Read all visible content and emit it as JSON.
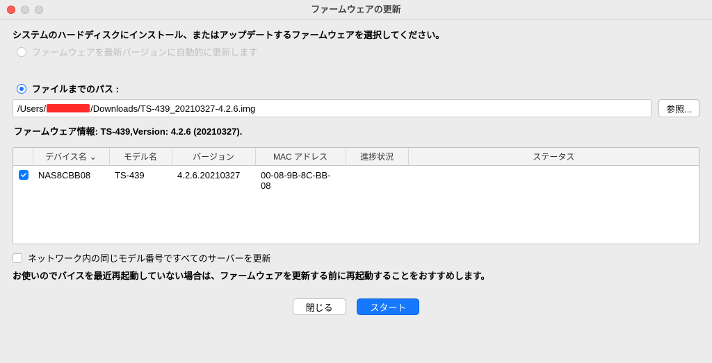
{
  "window": {
    "title": "ファームウェアの更新"
  },
  "instruction": "システムのハードディスクにインストール、またはアップデートするファームウェアを選択してください。",
  "radio_auto": {
    "label": "ファームウェアを最新バージョンに自動的に更新します",
    "enabled": false,
    "checked": false
  },
  "radio_path": {
    "label": "ファイルまでのパス :",
    "enabled": true,
    "checked": true
  },
  "path": {
    "prefix": "/Users/",
    "suffix": "/Downloads/TS-439_20210327-4.2.6.img"
  },
  "browse_label": "参照...",
  "firmware_info": "ファームウェア情報: TS-439,Version: 4.2.6 (20210327).",
  "table": {
    "headers": {
      "select": "",
      "device": "デバイス名",
      "model": "モデル名",
      "version": "バージョン",
      "mac": "MAC アドレス",
      "progress": "進捗状況",
      "status": "ステータス"
    },
    "rows": [
      {
        "selected": true,
        "device": "NAS8CBB08",
        "model": "TS-439",
        "version": "4.2.6.20210327",
        "mac": "00-08-9B-8C-BB-08",
        "progress": "",
        "status": ""
      }
    ]
  },
  "network_checkbox": {
    "label": "ネットワーク内の同じモデル番号ですべてのサーバーを更新",
    "checked": false
  },
  "advice": "お使いのでバイスを最近再起動していない場合は、ファームウェアを更新する前に再起動することをおすすめします。",
  "buttons": {
    "close": "閉じる",
    "start": "スタート"
  }
}
